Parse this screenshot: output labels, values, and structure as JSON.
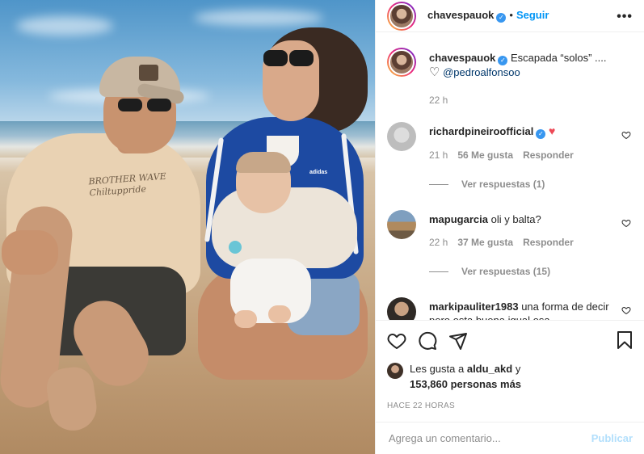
{
  "post": {
    "username": "chavespauok",
    "dot": "•",
    "follow_label": "Seguir",
    "more_label": "•••",
    "colors": {
      "accent": "#0095f6",
      "verified": "#3897f0",
      "secondary": "#8e8e8e",
      "like_red": "#ed4956"
    }
  },
  "photo": {
    "sweater_text_1": "BROTHER WAVE",
    "sweater_text_2": "Chiltuppride",
    "jacket_brand": "adidas"
  },
  "caption": {
    "username": "chavespauok",
    "text": "Escapada “solos” ....",
    "heart": "♡",
    "mention": "@pedroalfonsoo",
    "time": "22 h"
  },
  "comments": [
    {
      "username": "richardpineiroofficial",
      "verified": true,
      "text": "",
      "emoji": "♥",
      "time": "21 h",
      "likes": "56 Me gusta",
      "reply_label": "Responder",
      "view_replies": "Ver respuestas (1)"
    },
    {
      "username": "mapugarcia",
      "verified": false,
      "text": "oli y balta?",
      "time": "22 h",
      "likes": "37 Me gusta",
      "reply_label": "Responder",
      "view_replies": "Ver respuestas (15)"
    },
    {
      "username": "markipauliter1983",
      "verified": false,
      "text": "una forma de decir pero esta buena igual esa"
    }
  ],
  "actions": {
    "like_icon": "heart-icon",
    "comment_icon": "comment-icon",
    "share_icon": "share-icon",
    "save_icon": "bookmark-icon"
  },
  "likes": {
    "prefix": "Les gusta a",
    "user": "aldu_akd",
    "conj": "y",
    "count": "153,860 personas más"
  },
  "time_ago": "HACE 22 HORAS",
  "add_comment": {
    "placeholder": "Agrega un comentario...",
    "publish_label": "Publicar"
  }
}
